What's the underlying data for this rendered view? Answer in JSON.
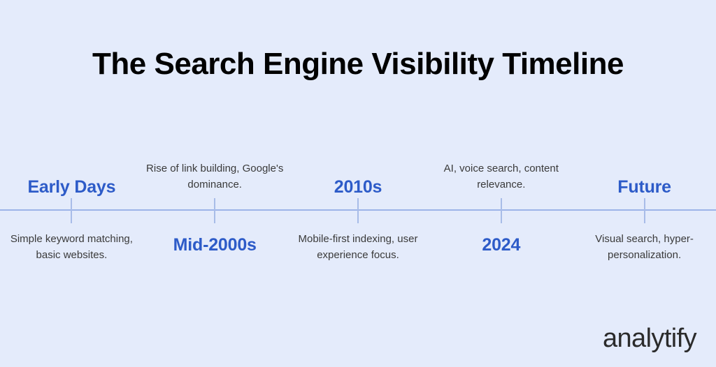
{
  "page": {
    "title": "The Search Engine Visibility Timeline",
    "background_color": "#e4ebfb",
    "accent_color": "#2d5bc8",
    "body_text_color": "#3a3a3a",
    "line_color": "#a8bce8"
  },
  "timeline": {
    "items": [
      {
        "label": "Early Days",
        "description": "Simple keyword matching, basic websites.",
        "label_position": "above"
      },
      {
        "label": "Mid-2000s",
        "description": "Rise of link building, Google's dominance.",
        "label_position": "below"
      },
      {
        "label": "2010s",
        "description": "Mobile-first indexing, user experience focus.",
        "label_position": "above"
      },
      {
        "label": "2024",
        "description": "AI, voice search, content relevance.",
        "label_position": "below"
      },
      {
        "label": "Future",
        "description": "Visual search, hyper-personalization.",
        "label_position": "above"
      }
    ]
  },
  "branding": {
    "logo_text": "analytify"
  }
}
